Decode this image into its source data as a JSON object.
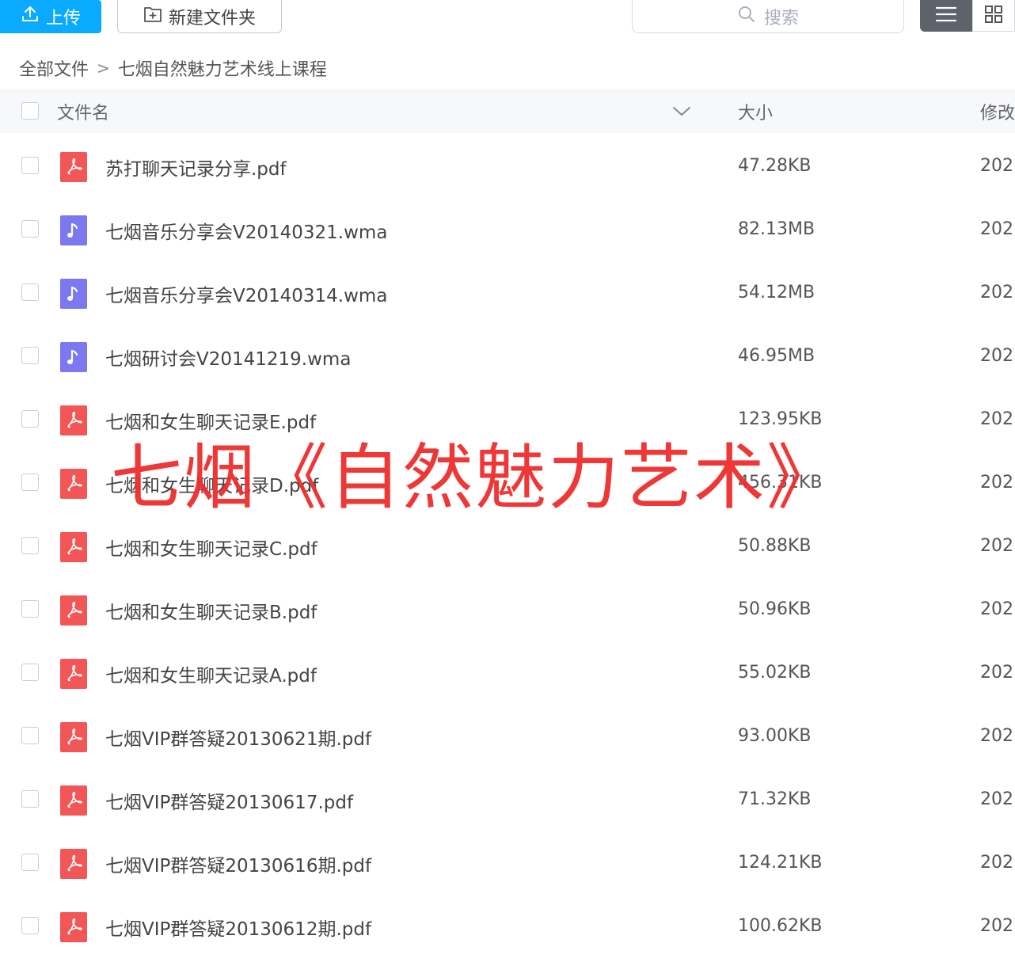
{
  "toolbar": {
    "upload_label": "上传",
    "new_folder_label": "新建文件夹",
    "search_placeholder": "搜索"
  },
  "colors": {
    "accent": "#09aaff",
    "pdf_icon": "#f25656",
    "audio_icon": "#7b78f0",
    "watermark": "#ee2e2e"
  },
  "breadcrumb": {
    "root": "全部文件",
    "separator": ">",
    "current": "七烟自然魅力艺术线上课程"
  },
  "table": {
    "col_name": "文件名",
    "col_size": "大小",
    "col_modified": "修改"
  },
  "files": [
    {
      "name": "苏打聊天记录分享.pdf",
      "size": "47.28KB",
      "date": "202",
      "type": "pdf"
    },
    {
      "name": "七烟音乐分享会V20140321.wma",
      "size": "82.13MB",
      "date": "202",
      "type": "audio"
    },
    {
      "name": "七烟音乐分享会V20140314.wma",
      "size": "54.12MB",
      "date": "202",
      "type": "audio"
    },
    {
      "name": "七烟研讨会V20141219.wma",
      "size": "46.95MB",
      "date": "202",
      "type": "audio"
    },
    {
      "name": "七烟和女生聊天记录E.pdf",
      "size": "123.95KB",
      "date": "202",
      "type": "pdf"
    },
    {
      "name": "七烟和女生聊天记录D.pdf",
      "size": "456.31KB",
      "date": "202",
      "type": "pdf"
    },
    {
      "name": "七烟和女生聊天记录C.pdf",
      "size": "50.88KB",
      "date": "202",
      "type": "pdf"
    },
    {
      "name": "七烟和女生聊天记录B.pdf",
      "size": "50.96KB",
      "date": "202",
      "type": "pdf"
    },
    {
      "name": "七烟和女生聊天记录A.pdf",
      "size": "55.02KB",
      "date": "202",
      "type": "pdf"
    },
    {
      "name": "七烟VIP群答疑20130621期.pdf",
      "size": "93.00KB",
      "date": "202",
      "type": "pdf"
    },
    {
      "name": "七烟VIP群答疑20130617.pdf",
      "size": "71.32KB",
      "date": "202",
      "type": "pdf"
    },
    {
      "name": "七烟VIP群答疑20130616期.pdf",
      "size": "124.21KB",
      "date": "202",
      "type": "pdf"
    },
    {
      "name": "七烟VIP群答疑20130612期.pdf",
      "size": "100.62KB",
      "date": "202",
      "type": "pdf"
    }
  ],
  "watermark": "七烟《自然魅力艺术》"
}
